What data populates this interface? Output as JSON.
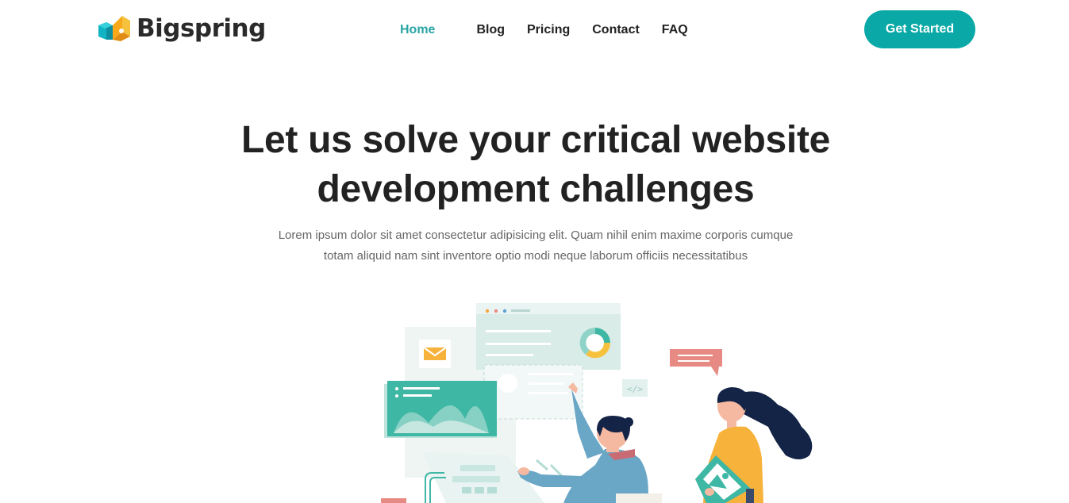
{
  "brand": {
    "name": "Bigspring"
  },
  "nav": {
    "items": [
      {
        "label": "Home",
        "active": true
      },
      {
        "label": "Blog",
        "active": false
      },
      {
        "label": "Pricing",
        "active": false
      },
      {
        "label": "Contact",
        "active": false
      },
      {
        "label": "FAQ",
        "active": false
      }
    ]
  },
  "header": {
    "cta_label": "Get Started"
  },
  "hero": {
    "title_line1": "Let us solve your critical website",
    "title_line2": "development challenges",
    "subtitle_line1": "Lorem ipsum dolor sit amet consectetur adipisicing elit. Quam nihil enim maxime corporis cumque",
    "subtitle_line2": "totam aliquid nam sint inventore optio modi neque laborum officiis necessitatibus"
  },
  "illustration": {
    "code_glyph": "</>"
  },
  "colors": {
    "accent": "#0aa8a7",
    "nav_active": "#2aa4a6",
    "text_dark": "#222222",
    "text_muted": "#666666",
    "teal_panel": "#3fb7a5",
    "coral": "#e88a84",
    "yellow": "#f9b233",
    "navy": "#1b2a4a"
  }
}
